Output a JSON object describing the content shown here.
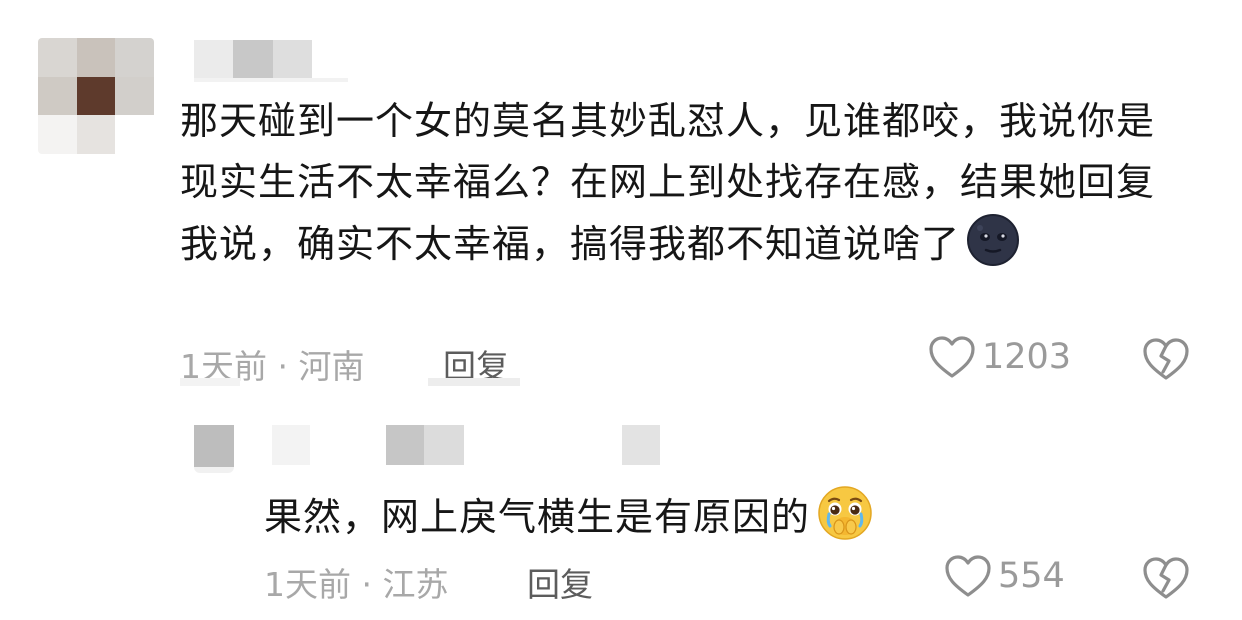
{
  "comments": [
    {
      "text": "那天碰到一个女的莫名其妙乱怼人，见谁都咬，我说你是现实生活不太幸福么？在网上到处找存在感，结果她回复我说，确实不太幸福，搞得我都不知道说啥了",
      "emoji_icon": "new-moon-face-emoji",
      "meta": "1天前 · 河南",
      "reply_label": "回复",
      "likes": "1203",
      "like_icon": "heart-outline-icon",
      "dislike_icon": "broken-heart-icon"
    },
    {
      "text": "果然，网上戾气横生是有原因的",
      "emoji_icon": "face-holding-back-tears-emoji",
      "meta": "1天前 · 江苏",
      "reply_label": "回复",
      "likes": "554",
      "like_icon": "heart-outline-icon",
      "dislike_icon": "broken-heart-icon"
    }
  ],
  "colors": {
    "text": "#161616",
    "meta": "#a8a8a8",
    "reply": "#5c5c5c",
    "icon": "#8e8e8e"
  }
}
